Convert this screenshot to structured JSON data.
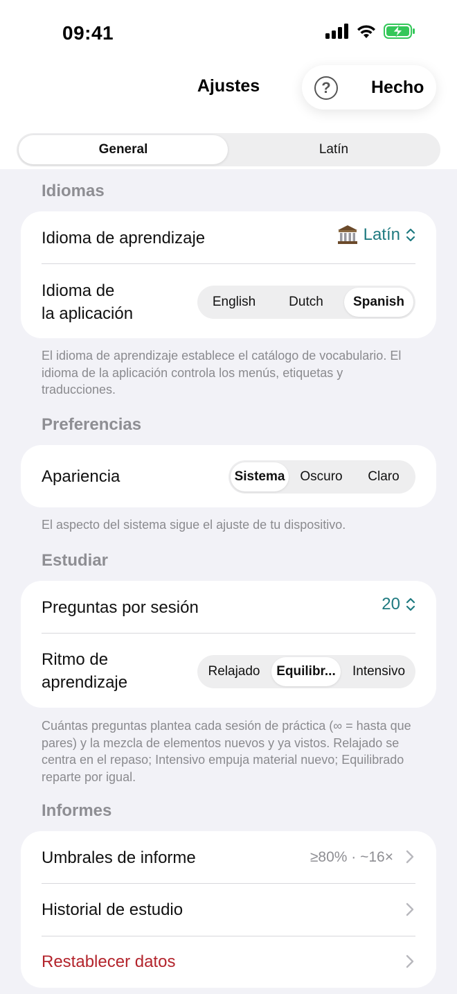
{
  "status_bar": {
    "time": "09:41"
  },
  "nav": {
    "title": "Ajustes",
    "help": "?",
    "done": "Hecho"
  },
  "tabs": [
    "General",
    "Latín"
  ],
  "sections": {
    "idiomas": {
      "title": "Idiomas",
      "learning_label": "Idioma de aprendizaje",
      "learning_value": "Latín",
      "app_label_line1": "Idioma de",
      "app_label_line2": "la aplicación",
      "app_options": [
        "English",
        "Dutch",
        "Spanish"
      ],
      "app_selected": "Spanish",
      "footnote": "El idioma de aprendizaje establece el catálogo de vocabulario. El idioma de la aplicación controla los menús, etiquetas y traducciones."
    },
    "preferencias": {
      "title": "Preferencias",
      "appearance_label": "Apariencia",
      "appearance_options": [
        "Sistema",
        "Oscuro",
        "Claro"
      ],
      "appearance_selected": "Sistema",
      "footnote": "El aspecto del sistema sigue el ajuste de tu dispositivo."
    },
    "estudiar": {
      "title": "Estudiar",
      "questions_label": "Preguntas por sesión",
      "questions_value": "20",
      "pace_label_line1": "Ritmo de",
      "pace_label_line2": "aprendizaje",
      "pace_options": [
        "Relajado",
        "Equilibr...",
        "Intensivo"
      ],
      "pace_selected": "Equilibr...",
      "footnote": "Cuántas preguntas plantea cada sesión de práctica (∞ = hasta que pares) y la mezcla de elementos nuevos y ya vistos. Relajado se centra en el repaso; Intensivo empuja material nuevo; Equilibrado reparte por igual."
    },
    "informes": {
      "title": "Informes",
      "thresholds_label": "Umbrales de informe",
      "thresholds_value": "≥80% · ~16×",
      "history_label": "Historial de estudio",
      "reset_label": "Restablecer datos"
    }
  },
  "colors": {
    "accent_teal": "#1f7a80",
    "danger_red": "#b3242c",
    "battery_green": "#34c759"
  },
  "icons": [
    "cellular-icon",
    "wifi-icon",
    "battery-charging-icon",
    "help-icon",
    "columns-building-icon",
    "chevron-up-down-icon",
    "chevron-right-icon"
  ]
}
